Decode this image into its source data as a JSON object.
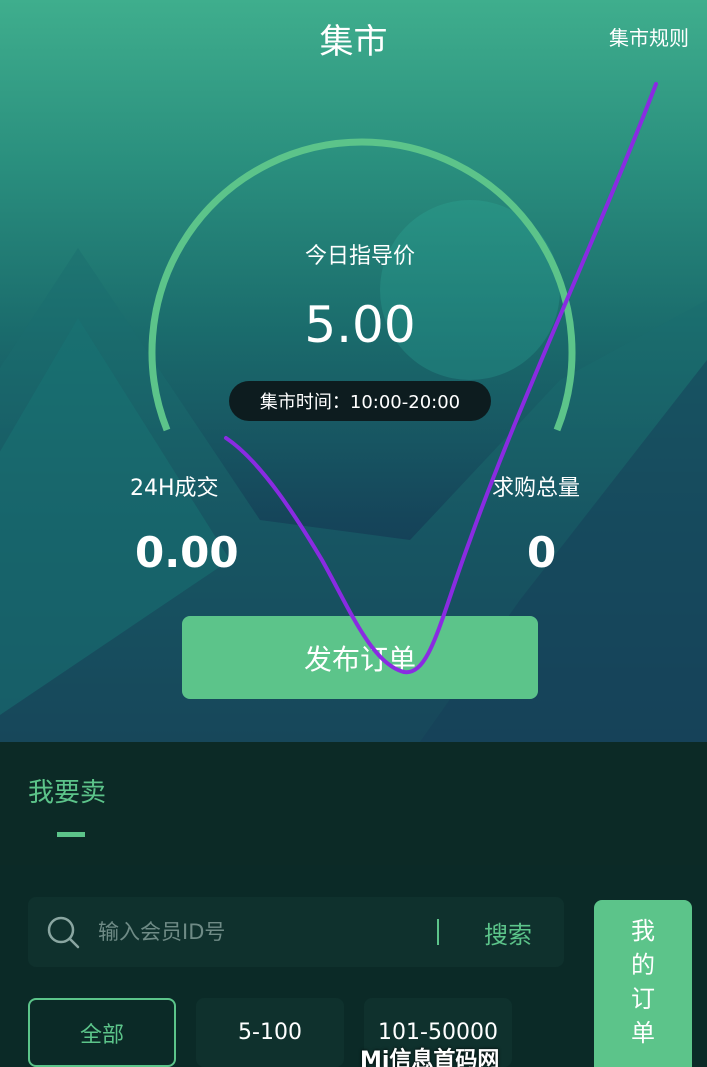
{
  "header": {
    "title": "集市",
    "rules_link": "集市规则"
  },
  "gauge": {
    "label": "今日指导价",
    "price": "5.00",
    "market_time": "集市时间：10:00-20:00"
  },
  "stats": {
    "volume_label": "24H成交",
    "volume_value": "0.00",
    "demand_label": "求购总量",
    "demand_value": "0"
  },
  "publish_button": "发布订单",
  "tabs": {
    "sell_label": "我要卖"
  },
  "search": {
    "placeholder": "输入会员ID号",
    "button_label": "搜索"
  },
  "my_orders": [
    "我",
    "的",
    "订",
    "单"
  ],
  "filters": [
    "全部",
    "5-100",
    "101-50000"
  ],
  "watermark": "Mi信息首码网  www.mixinxi.com",
  "colors": {
    "accent": "#5cc48a",
    "annotation": "#8a2be2",
    "dark_bg": "#0b2a27"
  }
}
